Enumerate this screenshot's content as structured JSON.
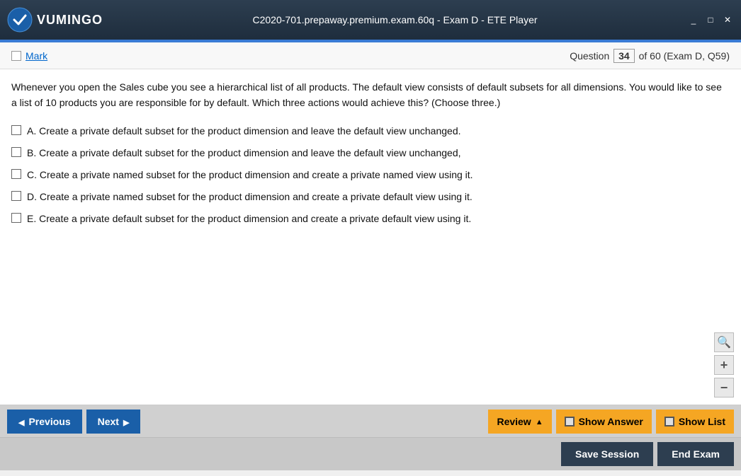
{
  "titleBar": {
    "title": "C2020-701.prepaway.premium.exam.60q - Exam D - ETE Player",
    "logoText": "VUMINGO",
    "controls": [
      "_",
      "□",
      "✕"
    ]
  },
  "questionBar": {
    "markLabel": "Mark",
    "questionLabel": "Question",
    "questionNumber": "34",
    "totalQuestions": "of 60 (Exam D, Q59)"
  },
  "questionContent": {
    "text": "Whenever you open the Sales cube you see a hierarchical list of all products. The default view consists of default subsets for all dimensions. You would like to see a list of 10 products you are responsible for by default. Which three actions would achieve this? (Choose three.)",
    "options": [
      "A. Create a private default subset for the product dimension and leave the default view unchanged.",
      "B. Create a private default subset for the product dimension and leave the default view unchanged,",
      "C. Create a private named subset for the product dimension and create a private named view using it.",
      "D. Create a private named subset for the product dimension and create a private default view using it.",
      "E. Create a private default subset for the product dimension and create a private default view using it."
    ]
  },
  "navigation": {
    "previousLabel": "Previous",
    "nextLabel": "Next",
    "reviewLabel": "Review",
    "showAnswerLabel": "Show Answer",
    "showListLabel": "Show List"
  },
  "actions": {
    "saveSessionLabel": "Save Session",
    "endExamLabel": "End Exam"
  }
}
